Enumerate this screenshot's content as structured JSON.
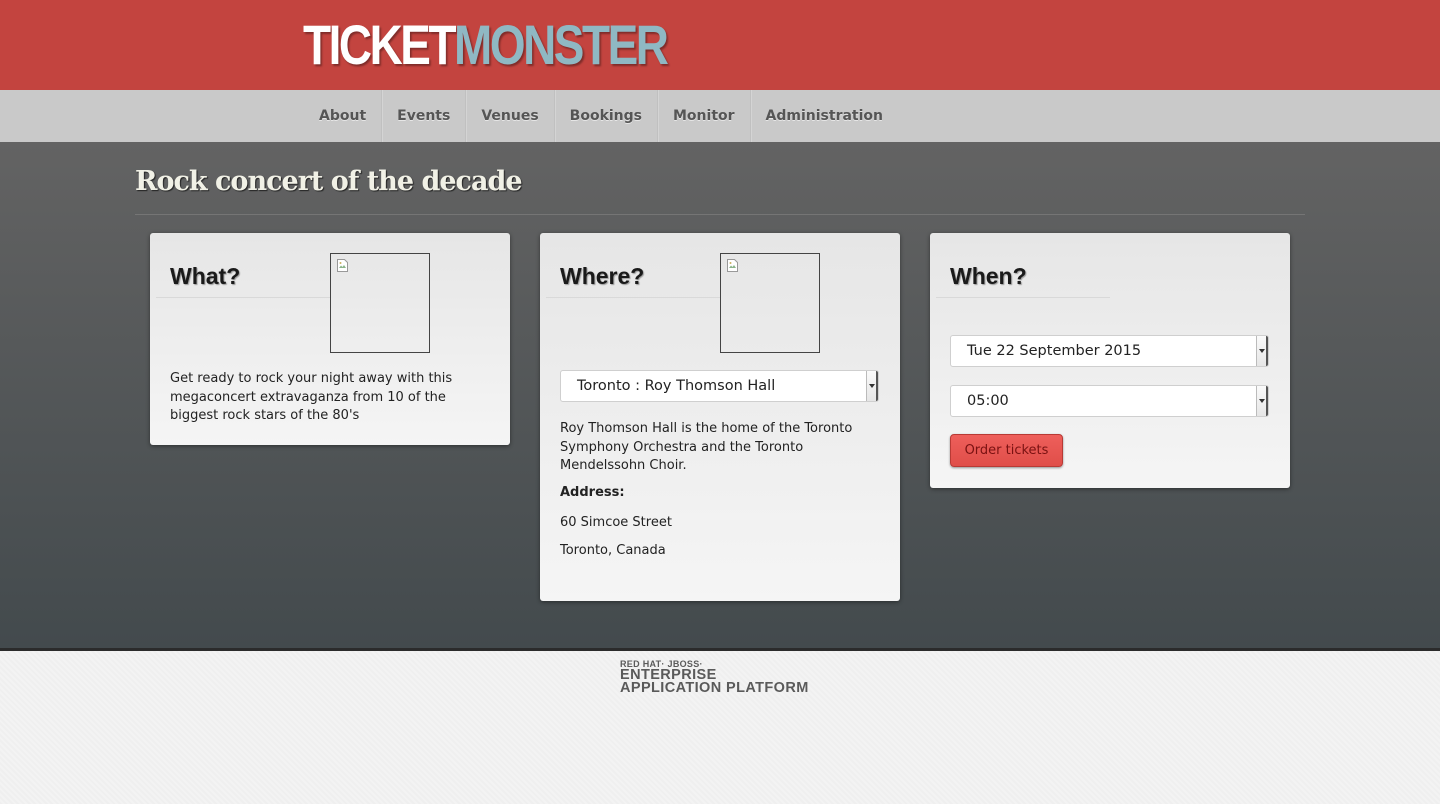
{
  "header": {
    "logo_part1": "TICKET",
    "logo_part2": "MONSTER"
  },
  "nav": {
    "items": [
      {
        "label": "About"
      },
      {
        "label": "Events"
      },
      {
        "label": "Venues"
      },
      {
        "label": "Bookings"
      },
      {
        "label": "Monitor"
      },
      {
        "label": "Administration"
      }
    ]
  },
  "event": {
    "title": "Rock concert of the decade"
  },
  "what": {
    "heading": "What?",
    "description": "Get ready to rock your night away with this megaconcert extravaganza from 10 of the biggest rock stars of the 80's"
  },
  "where": {
    "heading": "Where?",
    "venue_selected": "Toronto : Roy Thomson Hall",
    "description": "Roy Thomson Hall is the home of the Toronto Symphony Orchestra and the Toronto Mendelssohn Choir.",
    "address_label": "Address:",
    "address_line1": "60 Simcoe Street",
    "address_line2": "Toronto, Canada"
  },
  "when": {
    "heading": "When?",
    "date_selected": "Tue 22 September 2015",
    "time_selected": "05:00",
    "order_button": "Order tickets"
  },
  "footer": {
    "brand_line": "RED HAT· JBOSS·",
    "line1": "ENTERPRISE",
    "line2": "APPLICATION PLATFORM"
  },
  "colors": {
    "header_bg": "#c3443f",
    "navbar_bg": "#c9c9c9",
    "logo_accent": "#8fb8c3",
    "button_primary": "#ee5f5b"
  },
  "icons": {
    "broken_image": "broken-image-icon",
    "select_arrow": "chevron-down-icon"
  }
}
